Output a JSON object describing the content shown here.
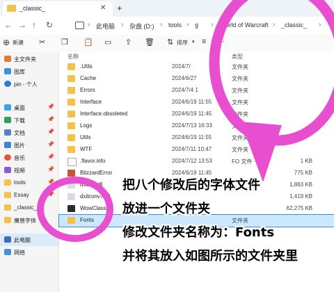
{
  "window": {
    "tab_title": "_classic_",
    "new_tab": "+"
  },
  "icons": {
    "folder": "folder-icon",
    "close": "close-icon",
    "plus": "plus-icon"
  },
  "nav": {
    "back": "←",
    "forward": "→",
    "up": "↑",
    "refresh": "↻"
  },
  "breadcrumb": [
    "此电脑",
    "杂盘 (D:)",
    "tools",
    "g",
    "World of Warcraft",
    "_classic_"
  ],
  "toolbar": {
    "new": "新建",
    "sort": "排序",
    "view": "查看",
    "more": "···"
  },
  "sidebar": {
    "items": [
      {
        "label": "主文件夹",
        "pinned": false
      },
      {
        "label": "图库",
        "pinned": false
      },
      {
        "label": "pin - 个人",
        "pinned": false
      },
      {
        "label": "桌面",
        "pinned": true
      },
      {
        "label": "下载",
        "pinned": true
      },
      {
        "label": "文档",
        "pinned": true
      },
      {
        "label": "图片",
        "pinned": true
      },
      {
        "label": "音乐",
        "pinned": true
      },
      {
        "label": "视频",
        "pinned": true
      },
      {
        "label": "tools",
        "pinned": true
      },
      {
        "label": "Essay",
        "pinned": true
      },
      {
        "label": "_classic_",
        "pinned": false
      },
      {
        "label": "魔兽字体",
        "pinned": false
      },
      {
        "label": "此电脑",
        "pinned": false
      },
      {
        "label": "网络",
        "pinned": false
      }
    ]
  },
  "columns": {
    "name": "名称",
    "type": "类型"
  },
  "files": [
    {
      "name": ".Utils",
      "date": "2024/7/",
      "type": "文件夹",
      "size": "",
      "kind": "folder"
    },
    {
      "name": "Cache",
      "date": "2024/6/27",
      "type": "文件夹",
      "size": "",
      "kind": "folder"
    },
    {
      "name": "Errors",
      "date": "2024/7/4 1",
      "type": "文件夹",
      "size": "",
      "kind": "folder"
    },
    {
      "name": "Interface",
      "date": "2024/6/19 11:55",
      "type": "文件夹",
      "size": "",
      "kind": "folder"
    },
    {
      "name": "Interface.obsoleted",
      "date": "2024/6/19 11:45",
      "type": "文件夹",
      "size": "",
      "kind": "folder"
    },
    {
      "name": "Logs",
      "date": "2024/7/13 16:33",
      "type": "文件夹",
      "size": "",
      "kind": "folder"
    },
    {
      "name": "Utils",
      "date": "2024/6/19 11:55",
      "type": "文件夹",
      "size": "",
      "kind": "folder"
    },
    {
      "name": "WTF",
      "date": "2024/7/11 10:47",
      "type": "文件夹",
      "size": "",
      "kind": "folder"
    },
    {
      "name": ".flavor.info",
      "date": "2024/7/12 13:53",
      "type": "FO 文件",
      "size": "1 KB",
      "kind": "file"
    },
    {
      "name": "BlizzardError",
      "date": "2024/6/19 11:45",
      "type": "",
      "size": "775 KB",
      "kind": "app"
    },
    {
      "name": "d3d12.dll",
      "date": "2024/6/",
      "type": "",
      "size": "1,863 KB",
      "kind": "dll"
    },
    {
      "name": "dxilconv7.dll",
      "date": "",
      "type": "",
      "size": "1,419 KB",
      "kind": "dll"
    },
    {
      "name": "WowClassic",
      "date": "",
      "type": "",
      "size": "62,275 KB",
      "kind": "exe"
    },
    {
      "name": "Fonts",
      "date": "",
      "type": "文件夹",
      "size": "",
      "kind": "folder",
      "selected": true
    }
  ],
  "annotation": {
    "lines": [
      "把八个修改后的字体文件",
      "放进一个文件夹",
      "修改文件夹名称为：Fonts",
      "并将其放入如图所示的文件夹里"
    ],
    "color": "#e84fd0"
  }
}
